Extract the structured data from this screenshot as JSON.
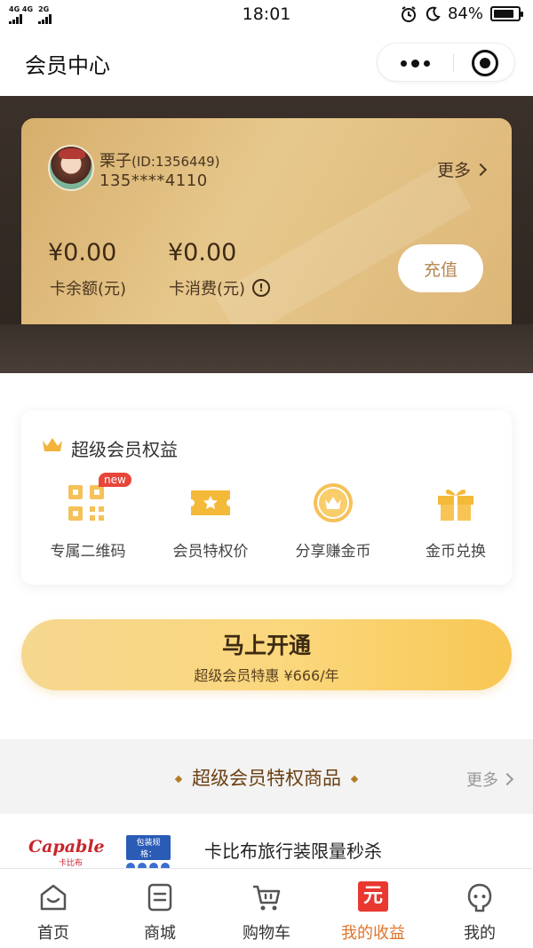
{
  "status_bar": {
    "network_1": "4G 4G",
    "network_2": "2G",
    "time": "18:01",
    "battery_text": "84%",
    "battery_level": 0.84
  },
  "nav": {
    "title": "会员中心"
  },
  "member_card": {
    "user_name": "栗子",
    "user_id": "(ID:1356449)",
    "phone": "135****4110",
    "more_label": "更多",
    "balance_value": "¥0.00",
    "balance_label": "卡余额(元)",
    "consume_value": "¥0.00",
    "consume_label": "卡消费(元)",
    "info_glyph": "!",
    "recharge_label": "充值"
  },
  "benefits": {
    "title": "超级会员权益",
    "new_badge": "new",
    "items": [
      {
        "label": "专属二维码",
        "icon": "qrcode-icon"
      },
      {
        "label": "会员特权价",
        "icon": "ticket-star-icon"
      },
      {
        "label": "分享赚金币",
        "icon": "coin-crown-icon"
      },
      {
        "label": "金币兑换",
        "icon": "gift-icon"
      }
    ]
  },
  "open_button": {
    "title": "马上开通",
    "subtitle": "超级会员特惠 ¥666/年"
  },
  "goods": {
    "title": "超级会员特权商品",
    "more_label": "更多"
  },
  "product": {
    "brand": "Capable",
    "brand_sub": "卡比布",
    "pack_label": "包装规格：",
    "name": "卡比布旅行装限量秒杀"
  },
  "tab_bar": {
    "items": [
      {
        "label": "首页",
        "icon": "home-icon"
      },
      {
        "label": "商城",
        "icon": "mall-icon"
      },
      {
        "label": "购物车",
        "icon": "cart-icon"
      },
      {
        "label": "我的收益",
        "icon": "yuan-icon",
        "glyph": "元"
      },
      {
        "label": "我的",
        "icon": "profile-icon"
      }
    ],
    "active_index": 3
  },
  "colors": {
    "accent_orange": "#e0742a",
    "gold": "#e7c88c",
    "badge_red": "#e8463a"
  }
}
